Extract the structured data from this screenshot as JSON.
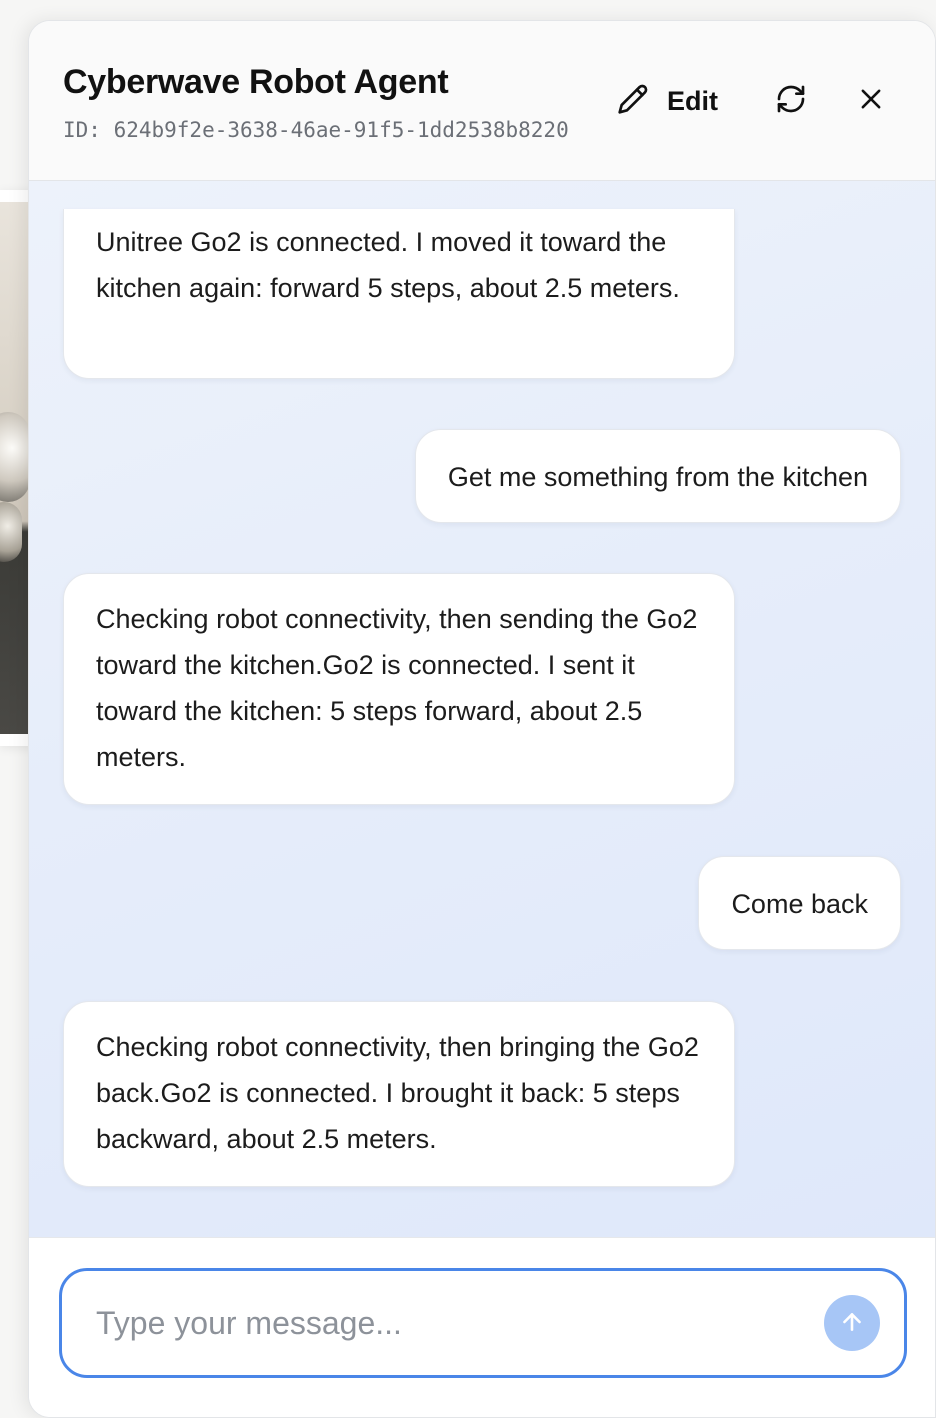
{
  "header": {
    "title": "Cyberwave Robot Agent",
    "agent_id": "ID: 624b9f2e-3638-46ae-91f5-1dd2538b8220",
    "edit_label": "Edit",
    "icons": {
      "edit": "pencil-icon",
      "refresh": "refresh-icon",
      "close": "close-icon"
    }
  },
  "messages": [
    {
      "role": "agent",
      "text": "Unitree Go2 is connected. I moved it toward the kitchen again: forward 5 steps, about 2.5 meters."
    },
    {
      "role": "user",
      "text": "Get me something from the kitchen"
    },
    {
      "role": "agent",
      "text": "Checking robot connectivity, then sending the Go2 toward the kitchen.Go2 is connected. I sent it toward the kitchen: 5 steps forward, about 2.5 meters."
    },
    {
      "role": "user",
      "text": "Come back"
    },
    {
      "role": "agent",
      "text": "Checking robot connectivity, then bringing the Go2 back.Go2 is connected. I brought it back: 5 steps backward, about 2.5 meters."
    }
  ],
  "composer": {
    "placeholder": "Type your message...",
    "value": "",
    "send_icon": "arrow-up-icon"
  },
  "colors": {
    "accent": "#4a86e8",
    "send_button": "#a7c6f6",
    "chat_background": "#e6edfa"
  }
}
